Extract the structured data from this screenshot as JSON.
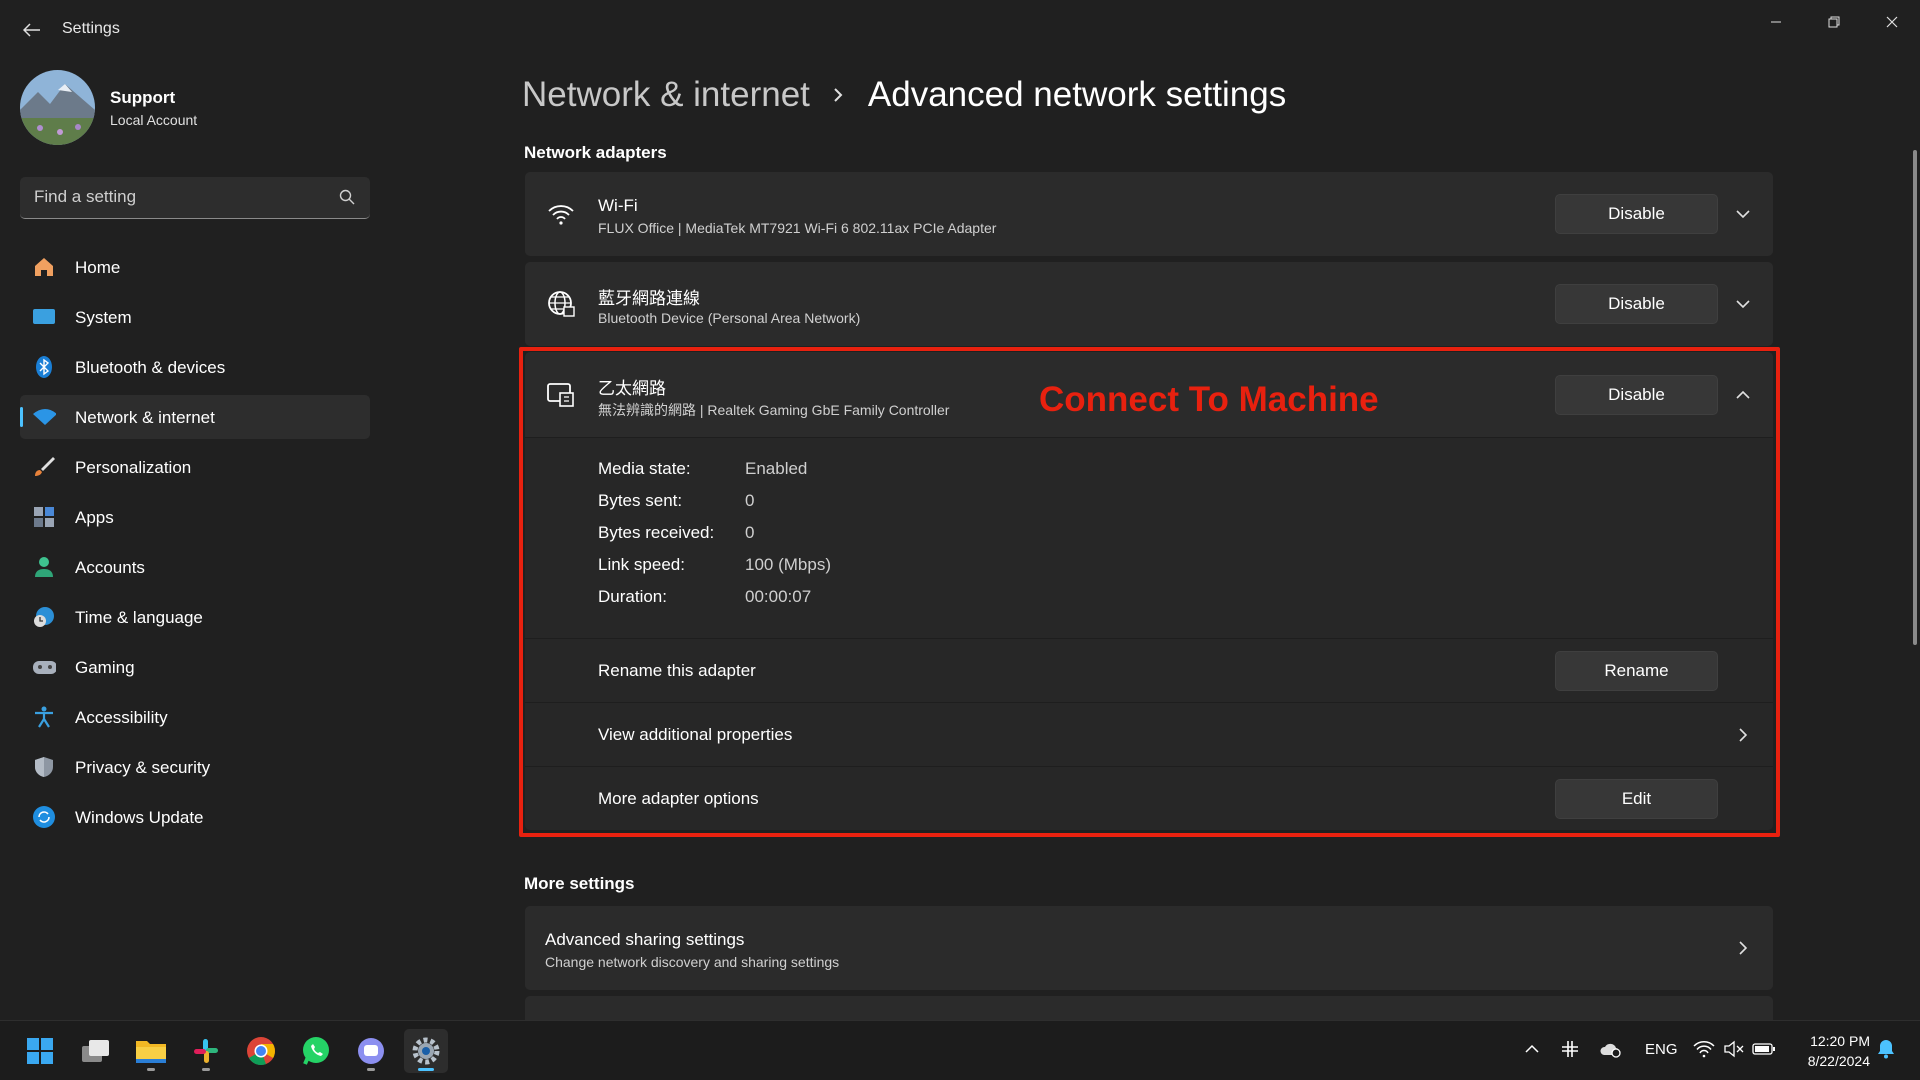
{
  "window": {
    "title": "Settings"
  },
  "profile": {
    "name": "Support",
    "account_type": "Local Account"
  },
  "search": {
    "placeholder": "Find a setting"
  },
  "sidebar": {
    "items": [
      {
        "label": "Home",
        "icon": "home-icon"
      },
      {
        "label": "System",
        "icon": "system-icon"
      },
      {
        "label": "Bluetooth & devices",
        "icon": "bluetooth-icon"
      },
      {
        "label": "Network & internet",
        "icon": "network-icon",
        "active": true
      },
      {
        "label": "Personalization",
        "icon": "brush-icon"
      },
      {
        "label": "Apps",
        "icon": "apps-icon"
      },
      {
        "label": "Accounts",
        "icon": "person-icon"
      },
      {
        "label": "Time & language",
        "icon": "globe-clock-icon"
      },
      {
        "label": "Gaming",
        "icon": "gamepad-icon"
      },
      {
        "label": "Accessibility",
        "icon": "accessibility-icon"
      },
      {
        "label": "Privacy & security",
        "icon": "shield-icon"
      },
      {
        "label": "Windows Update",
        "icon": "update-icon"
      }
    ]
  },
  "breadcrumb": {
    "parent": "Network & internet",
    "current": "Advanced network settings"
  },
  "adapters": {
    "section_title": "Network adapters",
    "wifi": {
      "name": "Wi-Fi",
      "description": "FLUX Office | MediaTek MT7921 Wi-Fi 6 802.11ax PCIe Adapter",
      "button": "Disable"
    },
    "bluetooth": {
      "name": "藍牙網路連線",
      "description": "Bluetooth Device (Personal Area Network)",
      "button": "Disable"
    },
    "ethernet": {
      "name": "乙太網路",
      "description": "無法辨識的網路 | Realtek Gaming GbE Family Controller",
      "button": "Disable",
      "details": {
        "media_state_label": "Media state:",
        "media_state": "Enabled",
        "bytes_sent_label": "Bytes sent:",
        "bytes_sent": "0",
        "bytes_received_label": "Bytes received:",
        "bytes_received": "0",
        "link_speed_label": "Link speed:",
        "link_speed": "100 (Mbps)",
        "duration_label": "Duration:",
        "duration": "00:00:07"
      },
      "rename_label": "Rename this adapter",
      "rename_button": "Rename",
      "properties_label": "View additional properties",
      "options_label": "More adapter options",
      "options_button": "Edit"
    }
  },
  "annotation": {
    "text": "Connect To Machine",
    "color": "#e8210f"
  },
  "more_settings": {
    "section_title": "More settings",
    "sharing": {
      "title": "Advanced sharing settings",
      "description": "Change network discovery and sharing settings"
    }
  },
  "taskbar": {
    "apps": [
      "start-icon",
      "task-view-icon",
      "file-explorer-icon",
      "slack-icon",
      "chrome-icon",
      "whatsapp-icon",
      "chat-icon",
      "settings-icon"
    ],
    "language": "ENG",
    "time": "12:20 PM",
    "date": "8/22/2024"
  },
  "colors": {
    "accent": "#4cc2ff",
    "background": "#202020",
    "card": "#2b2b2b",
    "highlight": "#e8210f"
  }
}
